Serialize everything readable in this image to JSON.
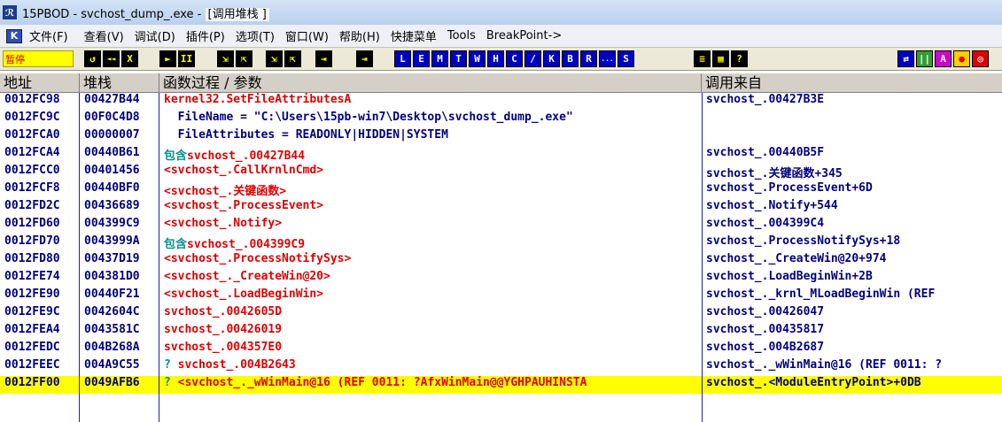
{
  "window": {
    "app_icon": "ollydbg-icon",
    "title": "15PBOD  - svchost_dump_.exe - ",
    "subtitle": "[调用堆栈 ]"
  },
  "menu": {
    "k_icon": "K",
    "items": [
      "文件(F)",
      "查看(V)",
      "调试(D)",
      "插件(P)",
      "选项(T)",
      "窗口(W)",
      "帮助(H)",
      "快捷菜单",
      "Tools",
      "BreakPoint->"
    ]
  },
  "toolbar": {
    "status": "暂停",
    "buttons": [
      "↺",
      "◄◄",
      "X",
      "►",
      "II",
      "⇲",
      "⇱",
      "⇲",
      "⇱",
      "⇥",
      "⇥",
      "L",
      "E",
      "M",
      "T",
      "W",
      "H",
      "C",
      "/",
      "K",
      "B",
      "R",
      "...",
      "S",
      "≡",
      "▦",
      "?",
      "⇄",
      "||",
      "A",
      "●",
      "◎"
    ],
    "colors": {
      "dark": "#000000",
      "blue": "#0000c0",
      "yellow": "#ffff00",
      "red": "#e00000",
      "status_bg": "#ffff00"
    }
  },
  "columns": {
    "addr": "地址",
    "stack": "堆栈",
    "proc": "函数过程 / 参数",
    "called_from": "调用来自"
  },
  "rows": [
    {
      "addr": "0012FC98",
      "stack": "00427B44",
      "proc_prefix": "",
      "proc": "kernel32.SetFileAttributesA",
      "proc_color": "red",
      "from": "svchost_.00427B3E",
      "highlight": false
    },
    {
      "addr": "0012FC9C",
      "stack": "00F0C4D8",
      "proc_prefix": "",
      "proc": "  FileName = \"C:\\Users\\15pb-win7\\Desktop\\svchost_dump_.exe\"",
      "proc_color": "blk",
      "from": "",
      "highlight": false
    },
    {
      "addr": "0012FCA0",
      "stack": "00000007",
      "proc_prefix": "",
      "proc": "  FileAttributes = READONLY|HIDDEN|SYSTEM",
      "proc_color": "blk",
      "from": "",
      "highlight": false
    },
    {
      "addr": "0012FCA4",
      "stack": "00440B61",
      "proc_prefix": "包含",
      "proc": "svchost_.00427B44",
      "proc_color": "red",
      "from": "svchost_.00440B5F",
      "highlight": false
    },
    {
      "addr": "0012FCC0",
      "stack": "00401456",
      "proc_prefix": "",
      "proc": "<svchost_.CallKrnlnCmd>",
      "proc_color": "red",
      "from": "svchost_.关键函数+345",
      "highlight": false
    },
    {
      "addr": "0012FCF8",
      "stack": "00440BF0",
      "proc_prefix": "",
      "proc": "<svchost_.关键函数>",
      "proc_color": "red",
      "from": "svchost_.ProcessEvent+6D",
      "highlight": false
    },
    {
      "addr": "0012FD2C",
      "stack": "00436689",
      "proc_prefix": "",
      "proc": "<svchost_.ProcessEvent>",
      "proc_color": "red",
      "from": "svchost_.Notify+544",
      "highlight": false
    },
    {
      "addr": "0012FD60",
      "stack": "004399C9",
      "proc_prefix": "",
      "proc": "<svchost_.Notify>",
      "proc_color": "red",
      "from": "svchost_.004399C4",
      "highlight": false
    },
    {
      "addr": "0012FD70",
      "stack": "0043999A",
      "proc_prefix": "包含",
      "proc": "svchost_.004399C9",
      "proc_color": "red",
      "from": "svchost_.ProcessNotifySys+18",
      "highlight": false
    },
    {
      "addr": "0012FD80",
      "stack": "00437D19",
      "proc_prefix": "",
      "proc": "<svchost_.ProcessNotifySys>",
      "proc_color": "red",
      "from": "svchost_._CreateWin@20+974",
      "highlight": false
    },
    {
      "addr": "0012FE74",
      "stack": "004381D0",
      "proc_prefix": "",
      "proc": "<svchost_._CreateWin@20>",
      "proc_color": "red",
      "from": "svchost_.LoadBeginWin+2B",
      "highlight": false
    },
    {
      "addr": "0012FE90",
      "stack": "00440F21",
      "proc_prefix": "",
      "proc": "<svchost_.LoadBeginWin>",
      "proc_color": "red",
      "from": "svchost_._krnl_MLoadBeginWin (REF",
      "highlight": false
    },
    {
      "addr": "0012FE9C",
      "stack": "0042604C",
      "proc_prefix": "",
      "proc": "svchost_.0042605D",
      "proc_color": "red",
      "from": "svchost_.00426047",
      "highlight": false
    },
    {
      "addr": "0012FEA4",
      "stack": "0043581C",
      "proc_prefix": "",
      "proc": "svchost_.00426019",
      "proc_color": "red",
      "from": "svchost_.00435817",
      "highlight": false
    },
    {
      "addr": "0012FEDC",
      "stack": "004B268A",
      "proc_prefix": "",
      "proc": "svchost_.004357E0",
      "proc_color": "red",
      "from": "svchost_.004B2687",
      "highlight": false
    },
    {
      "addr": "0012FEEC",
      "stack": "004A9C55",
      "proc_prefix": "? ",
      "proc": "svchost_.004B2643",
      "proc_color": "red",
      "from": "svchost_._wWinMain@16 (REF 0011: ?",
      "highlight": false
    },
    {
      "addr": "0012FF00",
      "stack": "0049AFB6",
      "proc_prefix": "? ",
      "proc": "<svchost_._wWinMain@16 (REF 0011: ?AfxWinMain@@YGHPAUHINSTA",
      "proc_color": "red",
      "from": "svchost_.<ModuleEntryPoint>+0DB",
      "highlight": true
    }
  ]
}
